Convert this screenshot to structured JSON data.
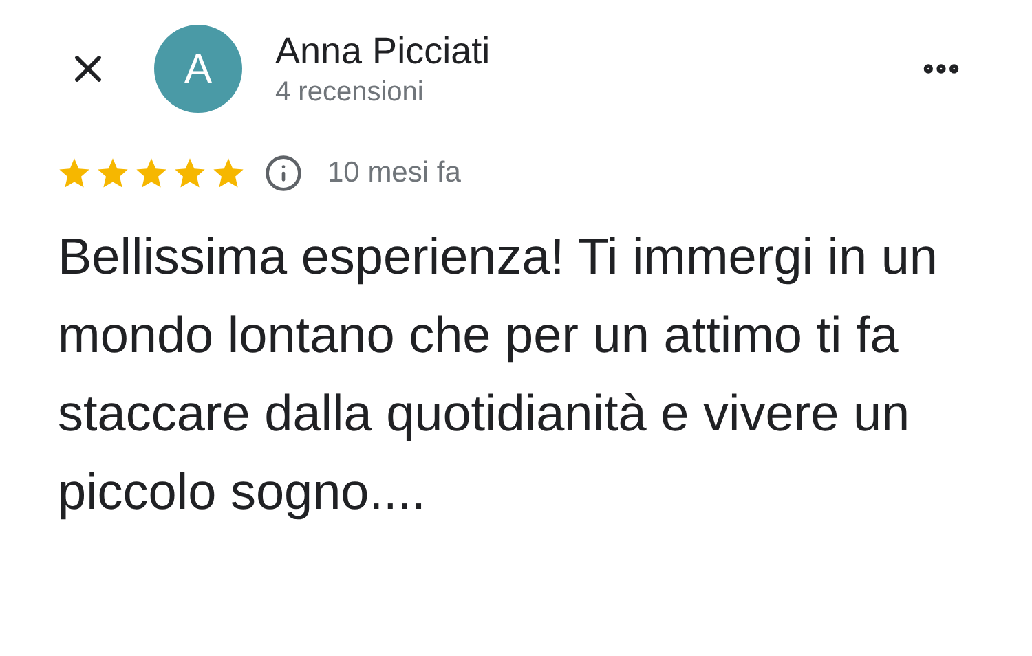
{
  "reviewer": {
    "initial": "A",
    "name": "Anna Picciati",
    "reviews": "4 recensioni"
  },
  "review": {
    "stars": 5,
    "time": "10 mesi fa",
    "text": "Bellissima esperienza! Ti immergi in un mondo lontano che per un attimo ti fa staccare dalla quotidianità e vivere un piccolo sogno...."
  }
}
